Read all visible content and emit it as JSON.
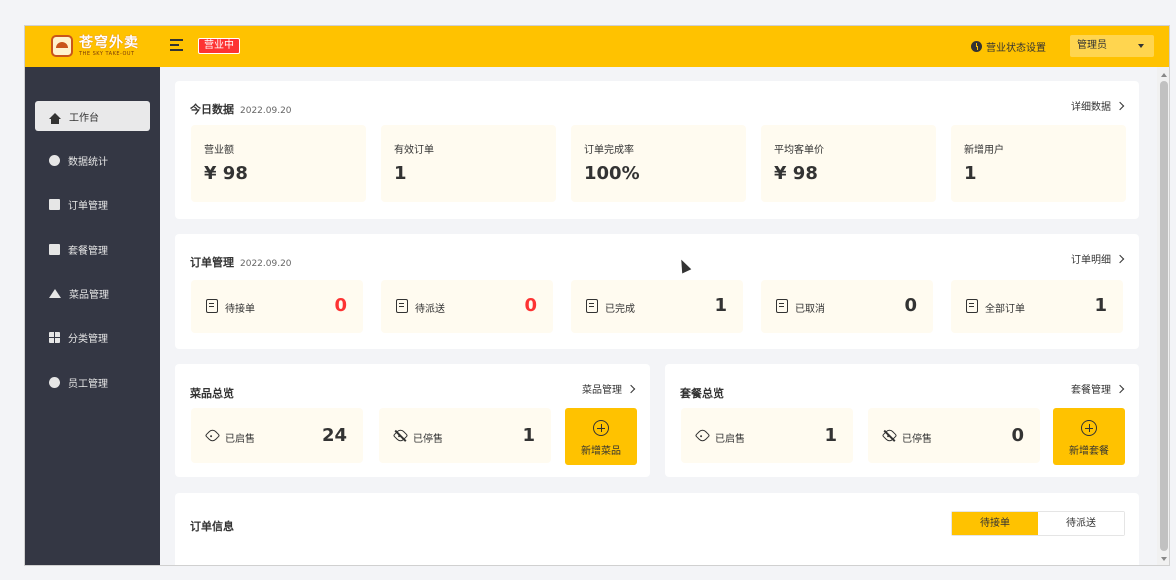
{
  "header": {
    "logo_cn": "苍穹外卖",
    "logo_en": "THE SKY TAKE-OUT",
    "status_badge": "营业中",
    "status_settings": "营业状态设置",
    "user": "管理员"
  },
  "sidebar": {
    "items": [
      {
        "label": "工作台",
        "icon": "home-icon"
      },
      {
        "label": "数据统计",
        "icon": "chart-icon"
      },
      {
        "label": "订单管理",
        "icon": "order-icon"
      },
      {
        "label": "套餐管理",
        "icon": "gift-icon"
      },
      {
        "label": "菜品管理",
        "icon": "dish-icon"
      },
      {
        "label": "分类管理",
        "icon": "grid-icon"
      },
      {
        "label": "员工管理",
        "icon": "info-icon"
      }
    ]
  },
  "today": {
    "title": "今日数据",
    "date": "2022.09.20",
    "link": "详细数据",
    "stats": [
      {
        "label": "营业额",
        "value": "¥ 98"
      },
      {
        "label": "有效订单",
        "value": "1"
      },
      {
        "label": "订单完成率",
        "value": "100%"
      },
      {
        "label": "平均客单价",
        "value": "¥ 98"
      },
      {
        "label": "新增用户",
        "value": "1"
      }
    ]
  },
  "orders": {
    "title": "订单管理",
    "date": "2022.09.20",
    "link": "订单明细",
    "items": [
      {
        "label": "待接单",
        "value": "0"
      },
      {
        "label": "待派送",
        "value": "0"
      },
      {
        "label": "已完成",
        "value": "1"
      },
      {
        "label": "已取消",
        "value": "0"
      },
      {
        "label": "全部订单",
        "value": "1"
      }
    ]
  },
  "dishes": {
    "title": "菜品总览",
    "link": "菜品管理",
    "on_label": "已启售",
    "on_value": "24",
    "off_label": "已停售",
    "off_value": "1",
    "add_label": "新增菜品"
  },
  "setmeals": {
    "title": "套餐总览",
    "link": "套餐管理",
    "on_label": "已启售",
    "on_value": "1",
    "off_label": "已停售",
    "off_value": "0",
    "add_label": "新增套餐"
  },
  "order_info": {
    "title": "订单信息",
    "tabs": [
      "待接单",
      "待派送"
    ]
  },
  "colors": {
    "accent": "#ffc200",
    "sidebar": "#343744",
    "alert": "#fd3333"
  }
}
